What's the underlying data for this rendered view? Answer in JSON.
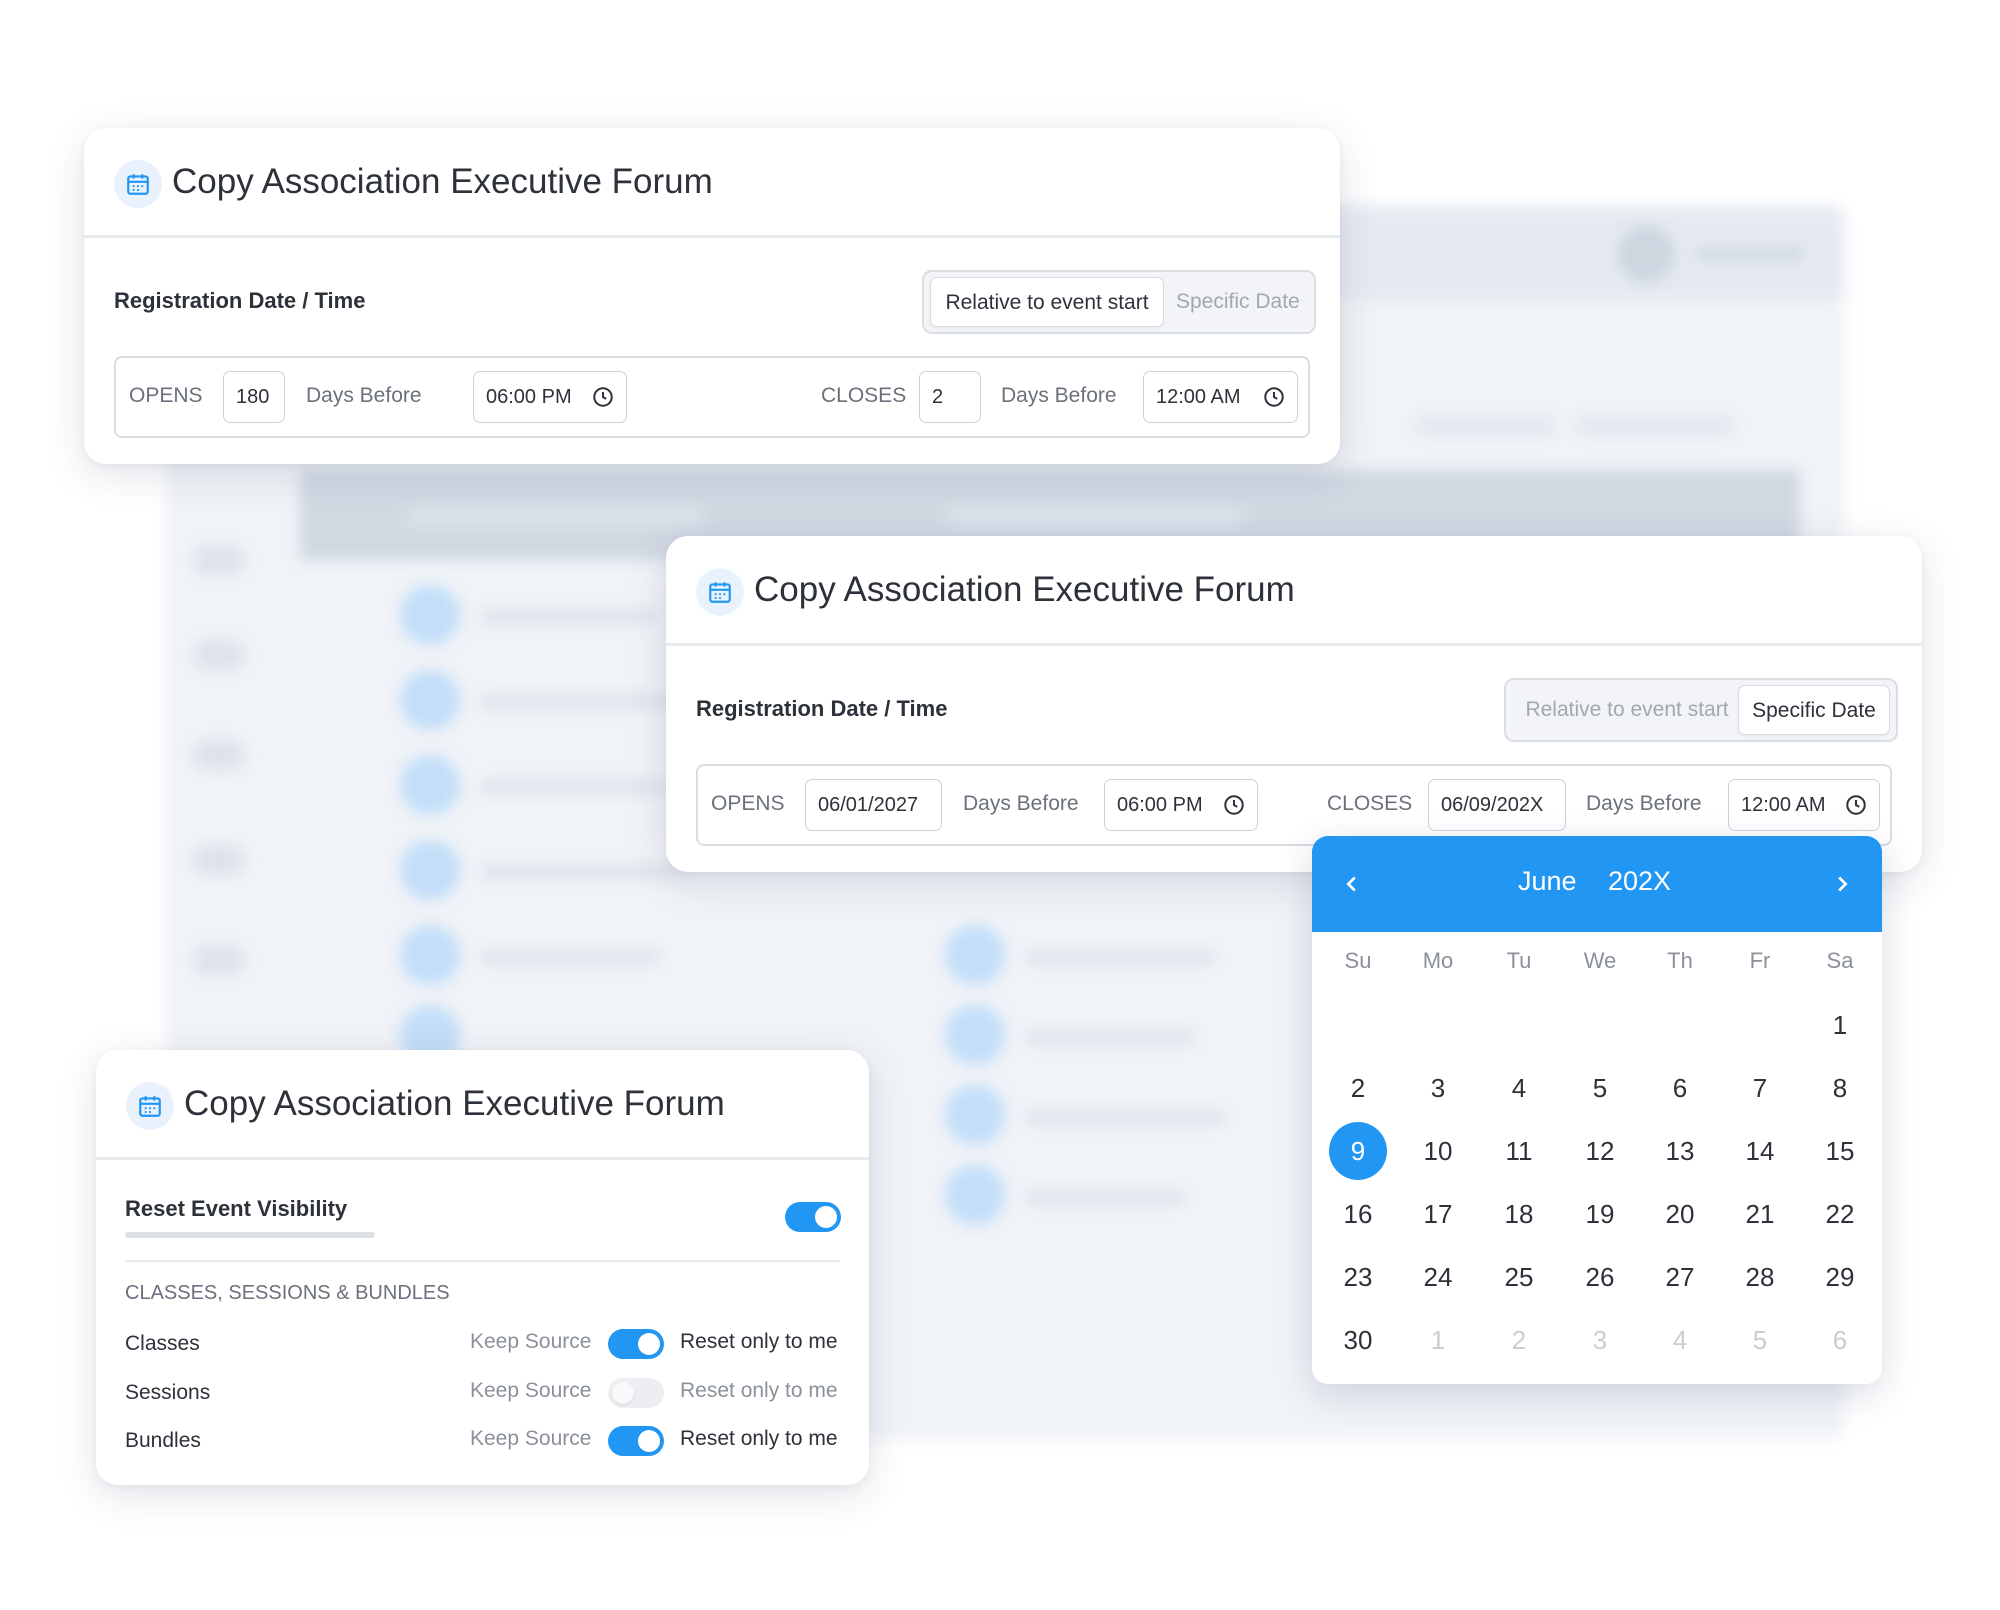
{
  "colors": {
    "accent": "#2196f3",
    "text": "#2d3139",
    "muted": "#a2a8b2"
  },
  "card_top": {
    "title": "Copy Association Executive Forum",
    "icon": "calendar-icon",
    "section_label": "Registration Date / Time",
    "mode_options": [
      "Relative to event start",
      "Specific Date"
    ],
    "active_mode": "Relative to event start",
    "opens_label": "OPENS",
    "opens_value": "180",
    "opens_unit": "Days Before",
    "opens_time": "06:00 PM",
    "closes_label": "CLOSES",
    "closes_value": "2",
    "closes_unit": "Days Before",
    "closes_time": "12:00 AM"
  },
  "card_middle": {
    "title": "Copy Association Executive Forum",
    "icon": "calendar-icon",
    "section_label": "Registration Date / Time",
    "mode_options": [
      "Relative to event start",
      "Specific Date"
    ],
    "active_mode": "Specific Date",
    "opens_label": "OPENS",
    "opens_value": "06/01/2027",
    "opens_unit": "Days Before",
    "opens_time": "06:00 PM",
    "closes_label": "CLOSES",
    "closes_value": "06/09/202X",
    "closes_unit": "Days Before",
    "closes_time": "12:00 AM"
  },
  "calendar": {
    "month": "June",
    "year": "202X",
    "weekdays": [
      "Su",
      "Mo",
      "Tu",
      "We",
      "Th",
      "Fr",
      "Sa"
    ],
    "weeks": [
      [
        "",
        "",
        "",
        "",
        "",
        "",
        "1"
      ],
      [
        "2",
        "3",
        "4",
        "5",
        "6",
        "7",
        "8"
      ],
      [
        "9",
        "10",
        "11",
        "12",
        "13",
        "14",
        "15"
      ],
      [
        "16",
        "17",
        "18",
        "19",
        "20",
        "21",
        "22"
      ],
      [
        "23",
        "24",
        "25",
        "26",
        "27",
        "28",
        "29"
      ],
      [
        "30",
        "1",
        "2",
        "3",
        "4",
        "5",
        "6"
      ]
    ],
    "selected_day": "9",
    "trailing_muted_count": 6
  },
  "card_visibility": {
    "title": "Copy Association Executive Forum",
    "icon": "calendar-icon",
    "reset_label": "Reset Event Visibility",
    "reset_on": true,
    "group_label": "CLASSES, SESSIONS & BUNDLES",
    "rows": [
      {
        "name": "Classes",
        "left": "Keep Source",
        "right": "Reset only to me",
        "on": true
      },
      {
        "name": "Sessions",
        "left": "Keep Source",
        "right": "Reset only to me",
        "on": false
      },
      {
        "name": "Bundles",
        "left": "Keep Source",
        "right": "Reset only to me",
        "on": true
      }
    ]
  }
}
